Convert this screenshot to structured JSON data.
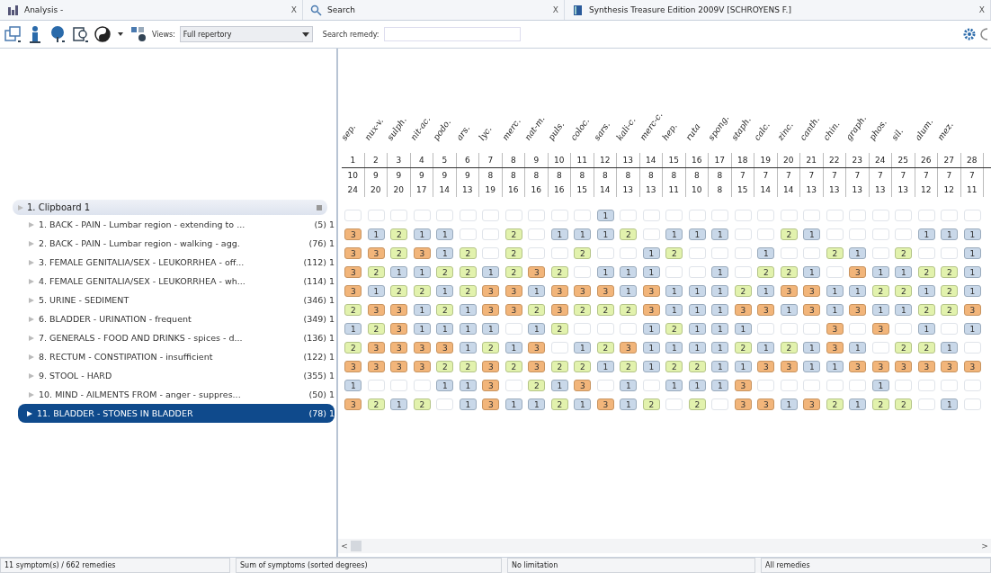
{
  "tabs": [
    {
      "label": "Analysis -",
      "close": "X"
    },
    {
      "label": "Search",
      "close": "X"
    },
    {
      "label": "Synthesis Treasure Edition 2009V [SCHROYENS F.]",
      "close": "X"
    }
  ],
  "toolbar": {
    "views_label": "Views:",
    "views_value": "Full repertory",
    "search_label": "Search remedy:"
  },
  "clipboard": {
    "title": "1. Clipboard 1"
  },
  "symptoms": [
    {
      "label": "1. BACK - PAIN - Lumbar region - extending to ...",
      "count": "(5)",
      "column_3": "1",
      "selected": false
    },
    {
      "label": "2. BACK - PAIN - Lumbar region - walking - agg.",
      "count": "(76)",
      "column_3": "1",
      "selected": false
    },
    {
      "label": "3. FEMALE GENITALIA/SEX - LEUKORRHEA - off...",
      "count": "(112)",
      "column_3": "1",
      "selected": false
    },
    {
      "label": "4. FEMALE GENITALIA/SEX - LEUKORRHEA - wh...",
      "count": "(114)",
      "column_3": "1",
      "selected": false
    },
    {
      "label": "5. URINE - SEDIMENT",
      "count": "(346)",
      "column_3": "1",
      "selected": false
    },
    {
      "label": "6. BLADDER - URINATION - frequent",
      "count": "(349)",
      "column_3": "1",
      "selected": false
    },
    {
      "label": "7. GENERALS - FOOD AND DRINKS - spices - d...",
      "count": "(136)",
      "column_3": "1",
      "selected": false
    },
    {
      "label": "8. RECTUM - CONSTIPATION - insufficient",
      "count": "(122)",
      "column_3": "1",
      "selected": false
    },
    {
      "label": "9. STOOL - HARD",
      "count": "(355)",
      "column_3": "1",
      "selected": false
    },
    {
      "label": "10. MIND - AILMENTS FROM - anger - suppres...",
      "count": "(50)",
      "column_3": "1",
      "selected": false
    },
    {
      "label": "11. BLADDER - STONES IN BLADDER",
      "count": "(78)",
      "column_3": "1",
      "selected": true
    }
  ],
  "remedies": {
    "names": [
      "sep.",
      "nux-v.",
      "sulph.",
      "nit-ac.",
      "podo.",
      "ars.",
      "lyc.",
      "merc.",
      "nat-m.",
      "puls.",
      "coloc.",
      "sars.",
      "kali-c.",
      "merc-c.",
      "hep.",
      "ruta",
      "spong.",
      "staph.",
      "calc.",
      "zinc.",
      "canth.",
      "chin.",
      "graph.",
      "phos.",
      "sil.",
      "alum.",
      "mez."
    ],
    "numbers": [
      "1",
      "2",
      "3",
      "4",
      "5",
      "6",
      "7",
      "8",
      "9",
      "10",
      "11",
      "12",
      "13",
      "14",
      "15",
      "16",
      "17",
      "18",
      "19",
      "20",
      "21",
      "22",
      "23",
      "24",
      "25",
      "26",
      "27",
      "28"
    ],
    "symptom_counts": [
      "10",
      "9",
      "9",
      "9",
      "9",
      "9",
      "8",
      "8",
      "8",
      "8",
      "8",
      "8",
      "8",
      "8",
      "8",
      "8",
      "8",
      "7",
      "7",
      "7",
      "7",
      "7",
      "7",
      "7",
      "7",
      "7",
      "7",
      "7"
    ],
    "degree_sums": [
      "24",
      "20",
      "20",
      "17",
      "14",
      "13",
      "19",
      "16",
      "16",
      "16",
      "15",
      "14",
      "13",
      "13",
      "11",
      "10",
      "8",
      "15",
      "14",
      "14",
      "13",
      "13",
      "13",
      "13",
      "13",
      "12",
      "12",
      "11"
    ]
  },
  "grid": [
    {
      "12": "1"
    },
    {
      "1": "3",
      "2": "1",
      "3": "2",
      "4": "1",
      "5": "1",
      "8": "2",
      "10": "1",
      "11": "1",
      "12": "1",
      "13": "2",
      "15": "1",
      "16": "1",
      "17": "1",
      "20": "2",
      "21": "1",
      "26": "1",
      "27": "1",
      "28": "1"
    },
    {
      "1": "3",
      "2": "3",
      "3": "2",
      "4": "3",
      "5": "1",
      "6": "2",
      "8": "2",
      "11": "2",
      "14": "1",
      "15": "2",
      "19": "1",
      "22": "2",
      "23": "1",
      "25": "2",
      "28": "1"
    },
    {
      "1": "3",
      "2": "2",
      "3": "1",
      "4": "1",
      "5": "2",
      "6": "2",
      "7": "1",
      "8": "2",
      "9": "3",
      "10": "2",
      "12": "1",
      "13": "1",
      "14": "1",
      "17": "1",
      "19": "2",
      "20": "2",
      "21": "1",
      "23": "3",
      "24": "1",
      "25": "1",
      "26": "2",
      "27": "2",
      "28": "1"
    },
    {
      "1": "3",
      "2": "1",
      "3": "2",
      "4": "2",
      "5": "1",
      "6": "2",
      "7": "3",
      "8": "3",
      "9": "1",
      "10": "3",
      "11": "3",
      "12": "3",
      "13": "1",
      "14": "3",
      "15": "1",
      "16": "1",
      "17": "1",
      "18": "2",
      "19": "1",
      "20": "3",
      "21": "3",
      "22": "1",
      "23": "1",
      "24": "2",
      "25": "2",
      "26": "1",
      "27": "2",
      "28": "1"
    },
    {
      "1": "2",
      "2": "3",
      "3": "3",
      "4": "1",
      "5": "2",
      "6": "1",
      "7": "3",
      "8": "3",
      "9": "2",
      "10": "3",
      "11": "2",
      "12": "2",
      "13": "2",
      "14": "3",
      "15": "1",
      "16": "1",
      "17": "1",
      "18": "3",
      "19": "3",
      "20": "1",
      "21": "3",
      "22": "1",
      "23": "3",
      "24": "1",
      "25": "1",
      "26": "2",
      "27": "2",
      "28": "3"
    },
    {
      "1": "1",
      "2": "2",
      "3": "3",
      "4": "1",
      "5": "1",
      "6": "1",
      "7": "1",
      "9": "1",
      "10": "2",
      "14": "1",
      "15": "2",
      "16": "1",
      "17": "1",
      "18": "1",
      "22": "3",
      "24": "3",
      "26": "1",
      "28": "1"
    },
    {
      "1": "2",
      "2": "3",
      "3": "3",
      "4": "3",
      "5": "3",
      "6": "1",
      "7": "2",
      "8": "1",
      "9": "3",
      "11": "1",
      "12": "2",
      "13": "3",
      "14": "1",
      "15": "1",
      "16": "1",
      "17": "1",
      "18": "2",
      "19": "1",
      "20": "2",
      "21": "1",
      "22": "3",
      "23": "1",
      "25": "2",
      "26": "2",
      "27": "1"
    },
    {
      "1": "3",
      "2": "3",
      "3": "3",
      "4": "3",
      "5": "2",
      "6": "2",
      "7": "3",
      "8": "2",
      "9": "3",
      "10": "2",
      "11": "2",
      "12": "1",
      "13": "2",
      "14": "1",
      "15": "2",
      "16": "2",
      "17": "1",
      "18": "1",
      "19": "3",
      "20": "3",
      "21": "1",
      "22": "1",
      "23": "3",
      "24": "3",
      "25": "3",
      "26": "3",
      "27": "3",
      "28": "3"
    },
    {
      "1": "1",
      "5": "1",
      "6": "1",
      "7": "3",
      "9": "2",
      "10": "1",
      "11": "3",
      "13": "1",
      "15": "1",
      "16": "1",
      "17": "1",
      "18": "3",
      "24": "1"
    },
    {
      "1": "3",
      "2": "2",
      "3": "1",
      "4": "2",
      "6": "1",
      "7": "3",
      "8": "1",
      "9": "1",
      "10": "2",
      "11": "1",
      "12": "3",
      "13": "1",
      "14": "2",
      "16": "2",
      "18": "3",
      "19": "3",
      "20": "1",
      "21": "3",
      "22": "2",
      "23": "1",
      "24": "2",
      "25": "2",
      "27": "1"
    }
  ],
  "scrollbar": {
    "left": "<",
    "right": ">"
  },
  "status_bar": [
    "11 symptom(s) / 662 remedies",
    "Sum of symptoms (sorted degrees)",
    "No limitation",
    "All remedies"
  ]
}
